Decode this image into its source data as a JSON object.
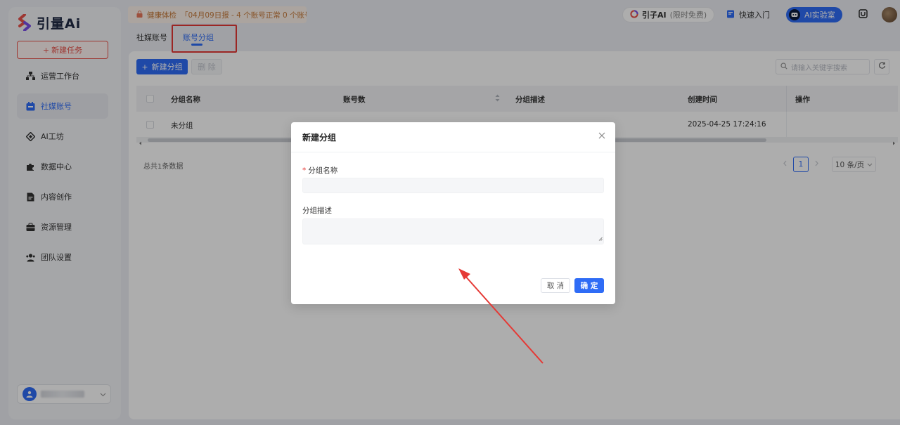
{
  "app": {
    "logo_text": "引量Ai"
  },
  "sidebar": {
    "new_task_label": "新建任务",
    "items": [
      {
        "label": "运营工作台",
        "icon": "org-chart-icon"
      },
      {
        "label": "社媒账号",
        "icon": "calendar-icon"
      },
      {
        "label": "AI工坊",
        "icon": "diamond-icon"
      },
      {
        "label": "数据中心",
        "icon": "puzzle-icon"
      },
      {
        "label": "内容创作",
        "icon": "document-icon"
      },
      {
        "label": "资源管理",
        "icon": "briefcase-icon"
      },
      {
        "label": "团队设置",
        "icon": "team-icon"
      }
    ],
    "active_index": 1
  },
  "topbar": {
    "notice_label": "健康体检",
    "notice_text": "「04月09日报 - 4 个账号正常 0 个账号...",
    "yinzi_label": "引子AI",
    "yinzi_note": "(限时免费)",
    "quick_entry_label": "快速入门",
    "ai_lab_label": "AI实验室"
  },
  "tabs": [
    {
      "label": "社媒账号",
      "active": false
    },
    {
      "label": "账号分组",
      "active": true
    }
  ],
  "toolbar": {
    "new_group_label": "新建分组",
    "delete_label": "删 除",
    "search_placeholder": "请输入关键字搜索"
  },
  "table": {
    "columns": [
      "分组名称",
      "账号数",
      "分组描述",
      "创建时间",
      "操作"
    ],
    "rows": [
      {
        "name": "未分组",
        "count": "",
        "desc": "",
        "created": "2025-04-25 17:24:16",
        "action": ""
      }
    ]
  },
  "footer": {
    "total_text": "总共1条数据",
    "current_page": "1",
    "page_size": "10 条/页"
  },
  "modal": {
    "title": "新建分组",
    "name_label": "分组名称",
    "desc_label": "分组描述",
    "cancel_label": "取 消",
    "confirm_label": "确 定"
  },
  "colors": {
    "primary": "#2f6cf6",
    "danger": "#e53935",
    "annotation": "#e53935"
  }
}
